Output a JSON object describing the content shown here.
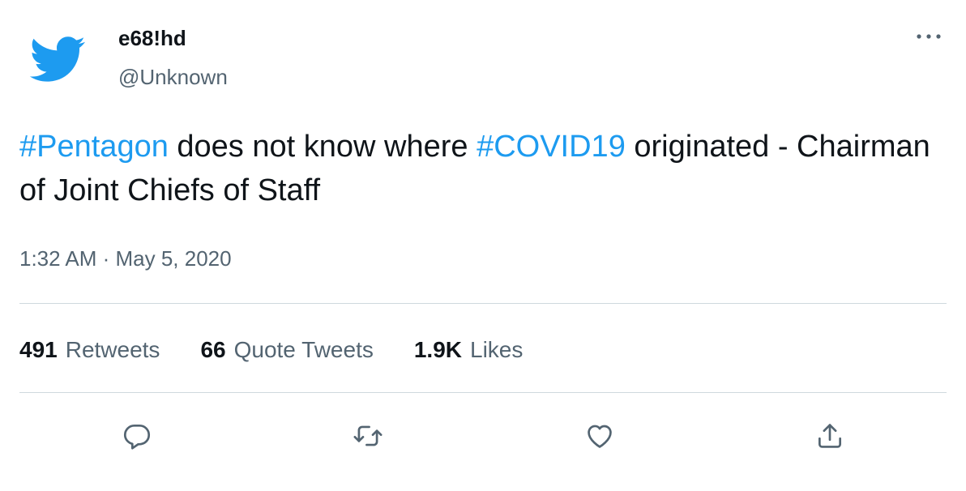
{
  "user": {
    "display_name": "e68!hd",
    "handle": "@Unknown",
    "avatar_icon": "twitter-bird-icon"
  },
  "tweet": {
    "hashtag_1": "#Pentagon",
    "text_1": " does not know where ",
    "hashtag_2": "#COVID19",
    "text_2": " originated - Chairman of Joint Chiefs of Staff",
    "timestamp": "1:32 AM · May 5, 2020"
  },
  "stats": {
    "retweets_count": "491",
    "retweets_label": "Retweets",
    "quotes_count": "66",
    "quotes_label": "Quote Tweets",
    "likes_count": "1.9K",
    "likes_label": "Likes"
  },
  "actions": [
    "reply-icon",
    "retweet-icon",
    "like-icon",
    "share-icon"
  ],
  "colors": {
    "accent": "#1d9bf0",
    "text_primary": "#0f1419",
    "text_secondary": "#536471",
    "divider": "#cfd9de"
  }
}
